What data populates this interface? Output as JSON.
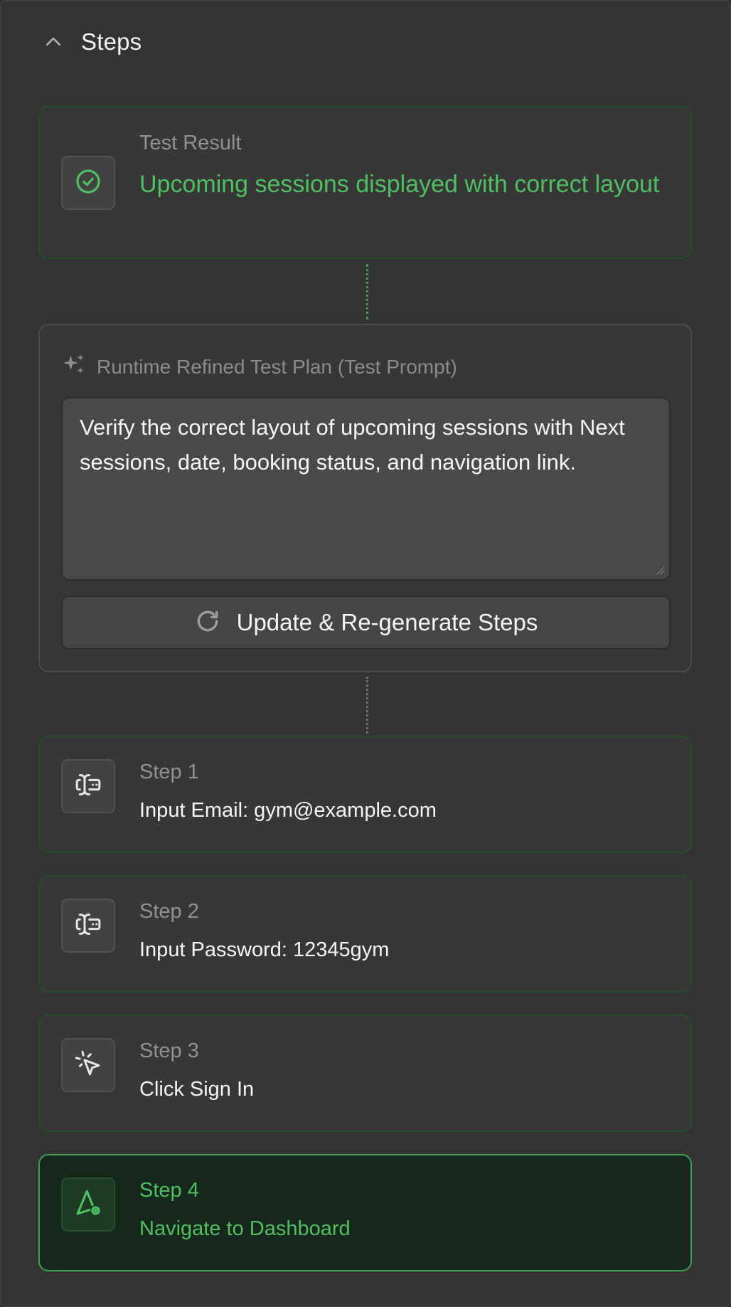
{
  "header": {
    "title": "Steps",
    "toggle_icon": "chevron-up-icon"
  },
  "result": {
    "label": "Test Result",
    "title": "Upcoming sessions displayed with correct layout",
    "icon": "check-circle-icon",
    "status_color": "#4fbf62"
  },
  "plan": {
    "label": "Runtime Refined Test Plan (Test Prompt)",
    "icon": "sparkles-icon",
    "prompt_text": "Verify the correct layout of upcoming sessions with Next sessions, date, booking status, and navigation link.",
    "regenerate_label": "Update & Re-generate Steps",
    "regenerate_icon": "refresh-icon"
  },
  "steps": [
    {
      "label": "Step 1",
      "action": "Input Email: gym@example.com",
      "icon": "text-cursor-input-icon"
    },
    {
      "label": "Step 2",
      "action": "Input Password: 12345gym",
      "icon": "text-cursor-input-icon"
    },
    {
      "label": "Step 3",
      "action": "Click Sign In",
      "icon": "mouse-pointer-click-icon"
    },
    {
      "label": "Step 4",
      "action": "Navigate to Dashboard",
      "icon": "navigation-pin-icon",
      "active": true
    }
  ],
  "colors": {
    "accent_green": "#4fbf62",
    "active_background": "#16281b",
    "panel_background": "#333433"
  }
}
